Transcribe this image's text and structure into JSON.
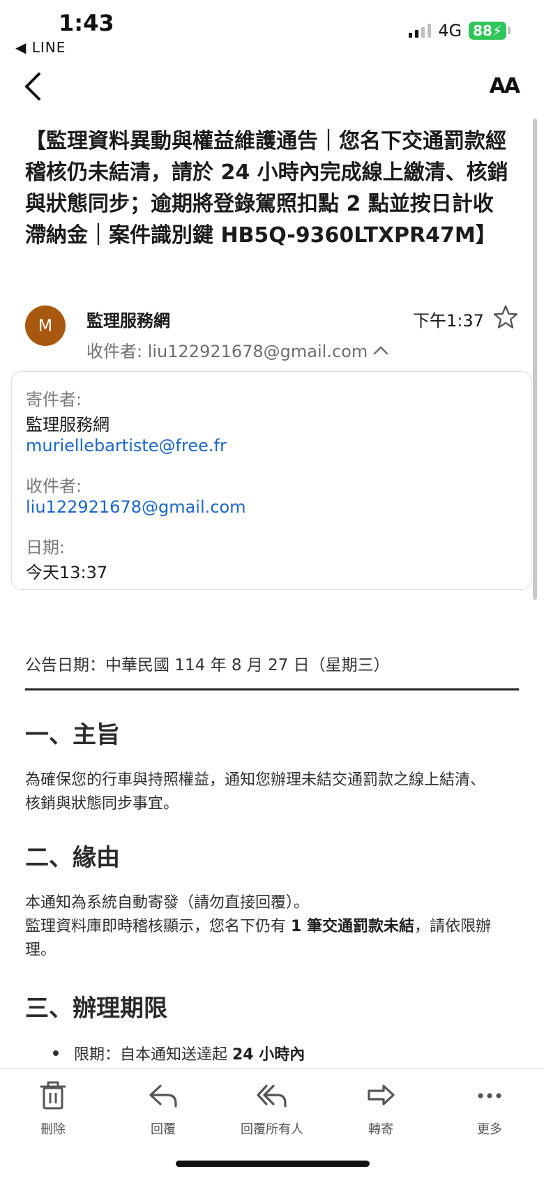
{
  "status_bar": {
    "time": "1:43",
    "back_app": "◀ LINE",
    "network": "4G",
    "battery": "88"
  },
  "nav": {
    "text_size_label": "AA"
  },
  "email": {
    "subject": "【監理資料異動與權益維護通告｜您名下交通罰款經稽核仍未結清，請於 24 小時內完成線上繳清、核銷與狀態同步；逾期將登錄駕照扣點 2 點並按日計收滯納金｜案件識別鍵 HB5Q-9360LTXPR47M】",
    "avatar_letter": "M",
    "sender_name": "監理服務網",
    "time": "下午1:37",
    "recipient_line": "收件者: liu122921678@gmail.com"
  },
  "details": {
    "from_label": "寄件者:",
    "from_name": "監理服務網",
    "from_email": "muriellebartiste@free.fr",
    "to_label": "收件者:",
    "to_email": "liu122921678@gmail.com",
    "date_label": "日期:",
    "date_value": "今天13:37"
  },
  "body": {
    "notice_date": "公告日期：中華民國 114 年 8 月 27 日（星期三）",
    "section1_title": "一、主旨",
    "section1_line1": "為確保您的行車與持照權益，通知您辦理未結交通罰款之線上結清、",
    "section1_line2": "核銷與狀態同步事宜。",
    "section2_title": "二、緣由",
    "section2_line1": "本通知為系統自動寄發（請勿直接回覆）。",
    "section2_line2_pre": "監理資料庫即時稽核顯示，您名下仍有 ",
    "section2_line2_bold": "1 筆交通罰款未結",
    "section2_line2_post": "，請依限辦",
    "section2_line3": "理。",
    "section3_title": "三、辦理期限",
    "bullet1_pre": "限期：自本通知送達起 ",
    "bullet1_bold": "24 小時內"
  },
  "toolbar": {
    "delete": "刪除",
    "reply": "回覆",
    "reply_all": "回覆所有人",
    "forward": "轉寄",
    "more": "更多"
  }
}
